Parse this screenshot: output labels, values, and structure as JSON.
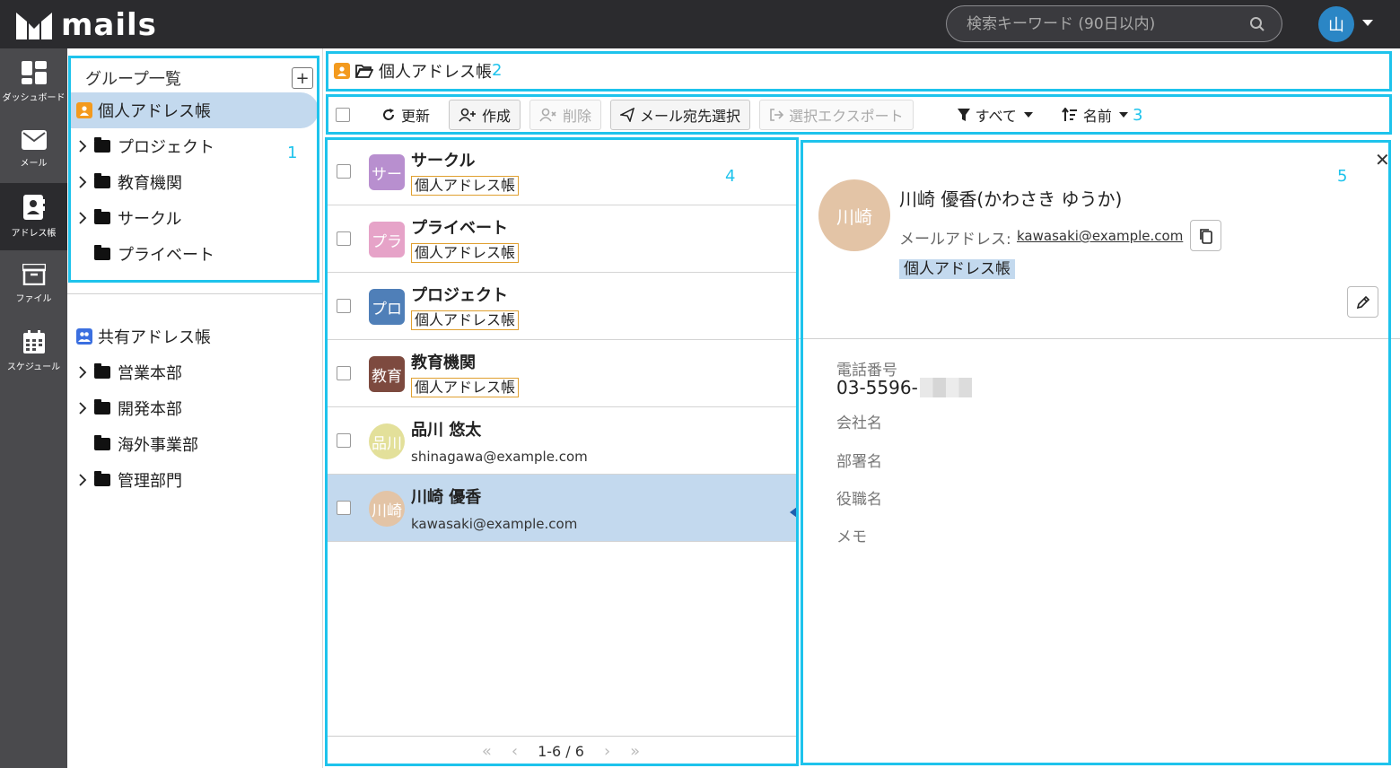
{
  "app": {
    "logo_text": "mails"
  },
  "search": {
    "placeholder": "検索キーワード (90日以内)"
  },
  "user": {
    "avatar": "山"
  },
  "rail": [
    {
      "label": "ダッシュボード",
      "icon": "dashboard-icon"
    },
    {
      "label": "メール",
      "icon": "mail-icon"
    },
    {
      "label": "アドレス帳",
      "icon": "address-book-icon"
    },
    {
      "label": "ファイル",
      "icon": "archive-icon"
    },
    {
      "label": "スケジュール",
      "icon": "calendar-icon"
    }
  ],
  "groups": {
    "title": "グループ一覧",
    "add": "+",
    "personal": "個人アドレス帳",
    "personal_children": [
      "プロジェクト",
      "教育機関",
      "サークル",
      "プライベート"
    ],
    "shared": "共有アドレス帳",
    "shared_children": [
      "営業本部",
      "開発本部",
      "海外事業部",
      "管理部門"
    ]
  },
  "breadcrumb": {
    "label": "個人アドレス帳"
  },
  "toolbar": {
    "refresh": "更新",
    "create": "作成",
    "delete": "削除",
    "mail_select": "メール宛先選択",
    "export": "選択エクスポート",
    "filter": "すべて",
    "sort": "名前"
  },
  "callouts": [
    "1",
    "2",
    "3",
    "4",
    "5"
  ],
  "list": {
    "rows": [
      {
        "avatar": "サー",
        "name": "サークル",
        "tag": "個人アドレス帳",
        "color": "#b88fcf"
      },
      {
        "avatar": "プラ",
        "name": "プライベート",
        "tag": "個人アドレス帳",
        "color": "#e6a3c8"
      },
      {
        "avatar": "プロ",
        "name": "プロジェクト",
        "tag": "個人アドレス帳",
        "color": "#4f7fb8"
      },
      {
        "avatar": "教育",
        "name": "教育機関",
        "tag": "個人アドレス帳",
        "color": "#7d4a3f"
      },
      {
        "avatar": "品川",
        "name": "品川 悠太",
        "email": "shinagawa@example.com",
        "color": "#e3e09a"
      },
      {
        "avatar": "川崎",
        "name": "川崎 優香",
        "email": "kawasaki@example.com",
        "color": "#e3c4a6"
      }
    ],
    "pager": "1-6 / 6"
  },
  "detail": {
    "avatar": "川崎",
    "name": "川崎 優香(かわさき ゆうか)",
    "email_label": "メールアドレス:",
    "email": "kawasaki@example.com",
    "tag": "個人アドレス帳",
    "phone_label": "電話番号",
    "phone": "03-5596-",
    "company_label": "会社名",
    "dept_label": "部署名",
    "title_label": "役職名",
    "memo_label": "メモ"
  }
}
